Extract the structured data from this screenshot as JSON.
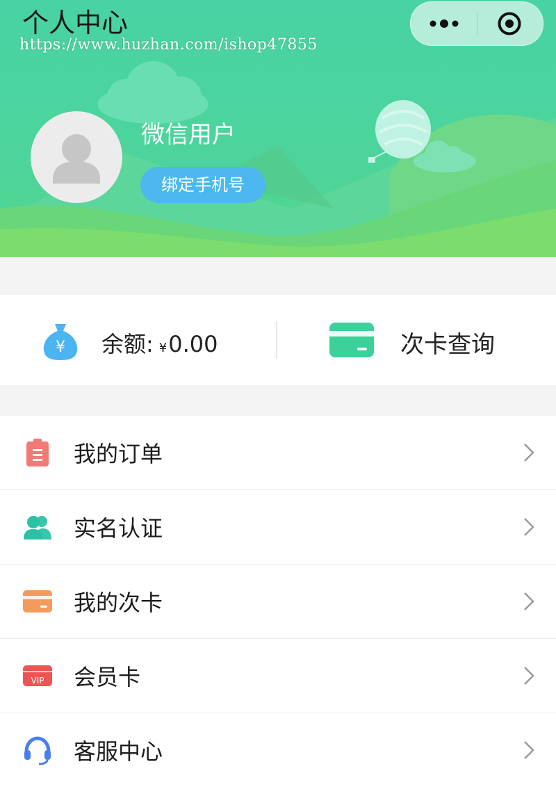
{
  "nav": {
    "title": "个人中心"
  },
  "watermark": "https://www.huzhan.com/ishop47855",
  "profile": {
    "username": "微信用户",
    "bind_phone": "绑定手机号"
  },
  "stats": {
    "balance_label": "余额:",
    "currency": "¥",
    "balance_value": "0.00",
    "card_query": "次卡查询"
  },
  "menu": [
    {
      "label": "我的订单",
      "icon": "order-clipboard-icon",
      "color": "#f27a76"
    },
    {
      "label": "实名认证",
      "icon": "users-icon",
      "color": "#2bc1a4"
    },
    {
      "label": "我的次卡",
      "icon": "card-icon",
      "color": "#f59a5a"
    },
    {
      "label": "会员卡",
      "icon": "vip-card-icon",
      "color": "#ee5454"
    },
    {
      "label": "客服中心",
      "icon": "headset-icon",
      "color": "#4a7ef0"
    }
  ],
  "colors": {
    "header_green": "#4cd49c",
    "bind_button": "#4cb8ef",
    "bag_blue": "#4cb4f1",
    "card_green": "#3dd09a"
  }
}
